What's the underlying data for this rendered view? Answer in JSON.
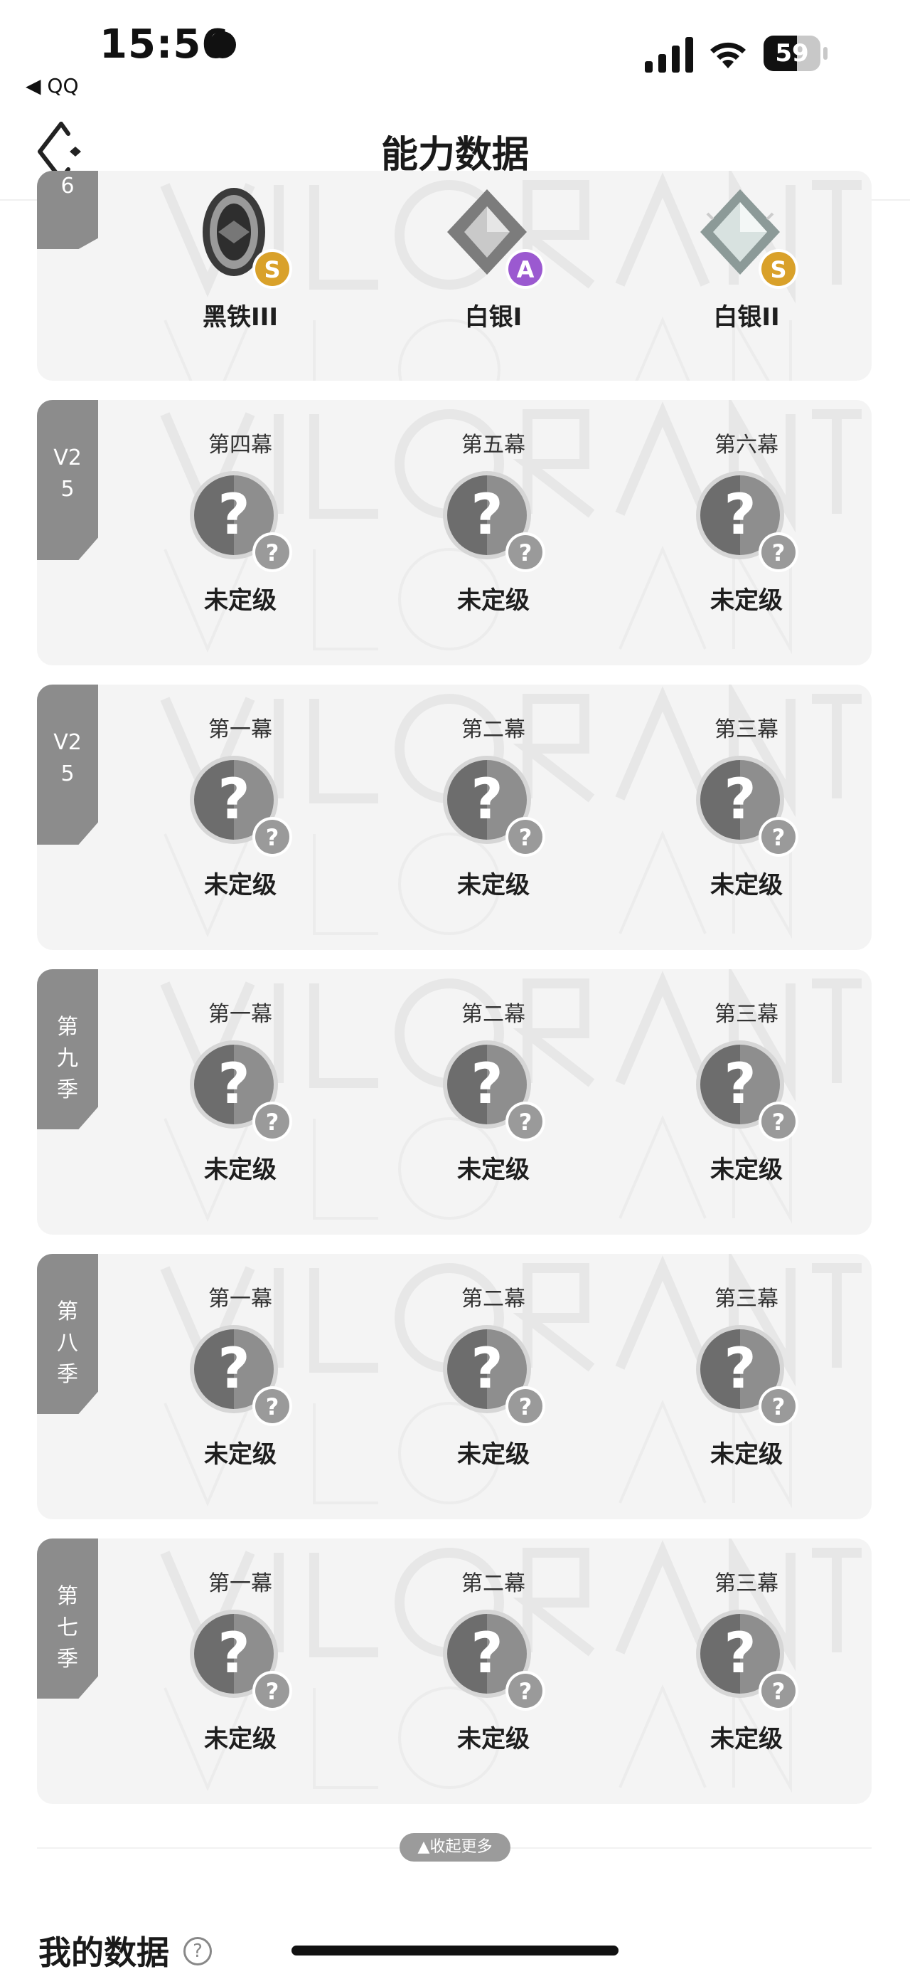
{
  "status_bar": {
    "time": "15:56",
    "back_app": "◀ QQ",
    "battery": "59",
    "battery_level": 0.59
  },
  "nav": {
    "title": "能力数据"
  },
  "cards": [
    {
      "tag": [
        "6"
      ],
      "slots": [
        {
          "act": "",
          "rank": "黑铁III",
          "kind": "iron",
          "grade": "S"
        },
        {
          "act": "",
          "rank": "白银I",
          "kind": "silver",
          "grade": "A"
        },
        {
          "act": "",
          "rank": "白银II",
          "kind": "silver2",
          "grade": "S"
        }
      ]
    },
    {
      "tag": [
        "V2",
        "5"
      ],
      "slots": [
        {
          "act": "第四幕",
          "rank": "未定级",
          "kind": "unranked",
          "grade": "?"
        },
        {
          "act": "第五幕",
          "rank": "未定级",
          "kind": "unranked",
          "grade": "?"
        },
        {
          "act": "第六幕",
          "rank": "未定级",
          "kind": "unranked",
          "grade": "?"
        }
      ]
    },
    {
      "tag": [
        "V2",
        "5"
      ],
      "slots": [
        {
          "act": "第一幕",
          "rank": "未定级",
          "kind": "unranked",
          "grade": "?"
        },
        {
          "act": "第二幕",
          "rank": "未定级",
          "kind": "unranked",
          "grade": "?"
        },
        {
          "act": "第三幕",
          "rank": "未定级",
          "kind": "unranked",
          "grade": "?"
        }
      ]
    },
    {
      "tag": [
        "第",
        "九",
        "季"
      ],
      "slots": [
        {
          "act": "第一幕",
          "rank": "未定级",
          "kind": "unranked",
          "grade": "?"
        },
        {
          "act": "第二幕",
          "rank": "未定级",
          "kind": "unranked",
          "grade": "?"
        },
        {
          "act": "第三幕",
          "rank": "未定级",
          "kind": "unranked",
          "grade": "?"
        }
      ]
    },
    {
      "tag": [
        "第",
        "八",
        "季"
      ],
      "slots": [
        {
          "act": "第一幕",
          "rank": "未定级",
          "kind": "unranked",
          "grade": "?"
        },
        {
          "act": "第二幕",
          "rank": "未定级",
          "kind": "unranked",
          "grade": "?"
        },
        {
          "act": "第三幕",
          "rank": "未定级",
          "kind": "unranked",
          "grade": "?"
        }
      ]
    },
    {
      "tag": [
        "第",
        "七",
        "季"
      ],
      "slots": [
        {
          "act": "第一幕",
          "rank": "未定级",
          "kind": "unranked",
          "grade": "?"
        },
        {
          "act": "第二幕",
          "rank": "未定级",
          "kind": "unranked",
          "grade": "?"
        },
        {
          "act": "第三幕",
          "rank": "未定级",
          "kind": "unranked",
          "grade": "?"
        }
      ]
    }
  ],
  "collapse_label": "▲收起更多",
  "section": {
    "title": "我的数据",
    "help": "?"
  },
  "colors": {
    "card_bg": "#f4f4f4",
    "tag_bg": "#8c8c8c",
    "grade_s": "#d9a12a",
    "grade_a": "#9b59d0",
    "grade_unknown": "#9a9a9a"
  }
}
